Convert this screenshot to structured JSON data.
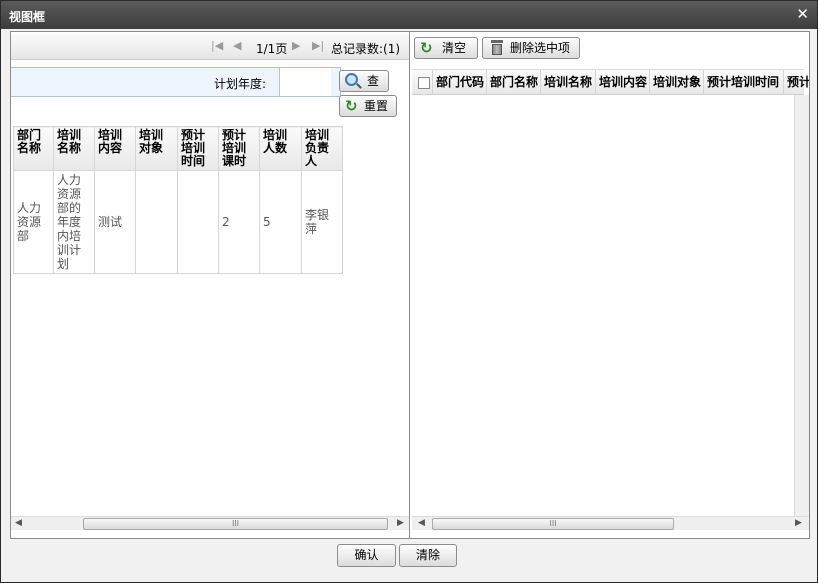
{
  "window": {
    "title": "视图框",
    "close_icon": "close-icon"
  },
  "left_panel": {
    "pager": {
      "page_text": "1/1页",
      "total_text": "总记录数:(1)"
    },
    "search": {
      "label": "计划年度:",
      "value": "",
      "search_label": "查",
      "reset_label": "重置"
    },
    "table": {
      "headers": [
        "部门名称",
        "培训名称",
        "培训内容",
        "培训对象",
        "预计培训时间",
        "预计培训课时",
        "培训人数",
        "培训负责人"
      ],
      "rows": [
        [
          "人力资源部",
          "人力资源部的年度内培训计划",
          "测试",
          "",
          "",
          "2",
          "5",
          "李银萍"
        ]
      ]
    },
    "scroll_thumb": "III"
  },
  "right_panel": {
    "toolbar": {
      "clear_label": "清空",
      "delete_label": "删除选中项"
    },
    "table": {
      "headers": [
        "部门代码",
        "部门名称",
        "培训名称",
        "培训内容",
        "培训对象",
        "预计培训时间",
        "预计"
      ]
    },
    "scroll_thumb": "III"
  },
  "footer": {
    "confirm_label": "确认",
    "clear_label": "清除"
  }
}
